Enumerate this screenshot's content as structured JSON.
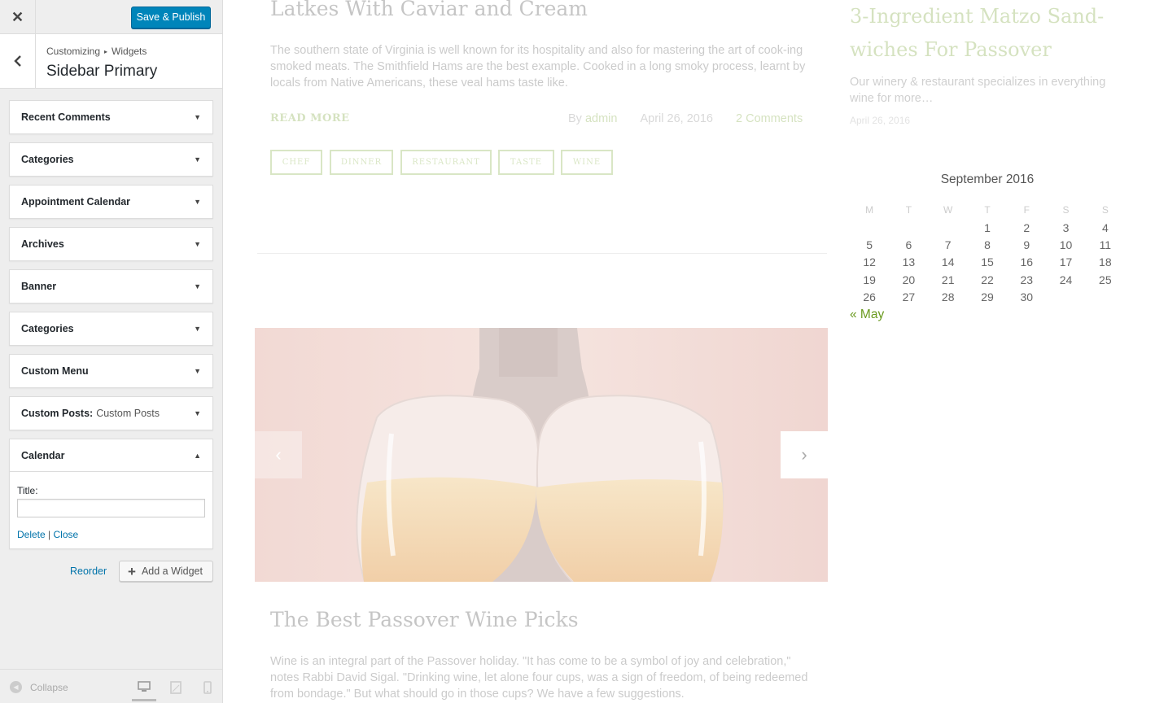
{
  "customizer": {
    "close_label": "✕",
    "publish_label": "Save & Publish",
    "breadcrumb": [
      "Customizing",
      "Widgets"
    ],
    "section_title": "Sidebar Primary",
    "widgets": [
      {
        "title": "Recent Comments"
      },
      {
        "title": "Categories"
      },
      {
        "title": "Appointment Calendar"
      },
      {
        "title": "Archives"
      },
      {
        "title": "Banner"
      },
      {
        "title": "Categories"
      },
      {
        "title": "Custom Menu"
      },
      {
        "title": "Custom Posts:",
        "in_title": "Custom Posts"
      },
      {
        "title": "Calendar",
        "expanded": true
      }
    ],
    "calendar_widget": {
      "title_label": "Title:",
      "title_value": "",
      "delete_label": "Delete",
      "separator": "|",
      "close_label": "Close"
    },
    "reorder_label": "Reorder",
    "add_widget_label": "Add a Widget",
    "collapse_label": "Collapse",
    "devices": [
      "desktop-icon",
      "tablet-icon",
      "mobile-icon"
    ]
  },
  "preview": {
    "post1": {
      "title": "Latkes With Caviar and Cream",
      "excerpt": "The southern state of Virginia is well known for its hospitality and also for mastering the art of cook-ing smoked meats. The Smithfield Hams are the best example. Cooked in a long smoky process, learnt by locals from Native Americans, these veal hams taste like.",
      "read_more": "READ MORE",
      "by": "By",
      "author": "admin",
      "date": "April 26, 2016",
      "comments": "2 Comments",
      "tags": [
        "CHEF",
        "DINNER",
        "RESTAURANT",
        "TASTE",
        "WINE"
      ]
    },
    "post2": {
      "title": "The Best Passover Wine Picks",
      "excerpt": "Wine is an integral part of the Passover holiday. \"It has come to be a symbol of joy and celebration,\" notes Rabbi David Sigal. \"Drinking wine, let alone four cups, was a sign of freedom, of being redeemed from bondage.\" But what should go in those cups? We have a few suggestions."
    },
    "slider": {
      "prev": "‹",
      "next": "›"
    },
    "recent_post": {
      "title": "3-Ingredient Matzo Sand-wiches For Passover",
      "excerpt": "Our winery & restaurant specializes in everything wine for more…",
      "date": "April 26, 2016"
    },
    "calendar": {
      "caption": "September 2016",
      "days": [
        "M",
        "T",
        "W",
        "T",
        "F",
        "S",
        "S"
      ],
      "weeks": [
        [
          "",
          "",
          "",
          "1",
          "2",
          "3",
          "4"
        ],
        [
          "5",
          "6",
          "7",
          "8",
          "9",
          "10",
          "11"
        ],
        [
          "12",
          "13",
          "14",
          "15",
          "16",
          "17",
          "18"
        ],
        [
          "19",
          "20",
          "21",
          "22",
          "23",
          "24",
          "25"
        ],
        [
          "26",
          "27",
          "28",
          "29",
          "30",
          "",
          ""
        ]
      ],
      "prev_link": "« May"
    }
  },
  "colors": {
    "publish": "#0085ba",
    "link": "#0073aa",
    "accent_green": "#6a9a1f"
  }
}
